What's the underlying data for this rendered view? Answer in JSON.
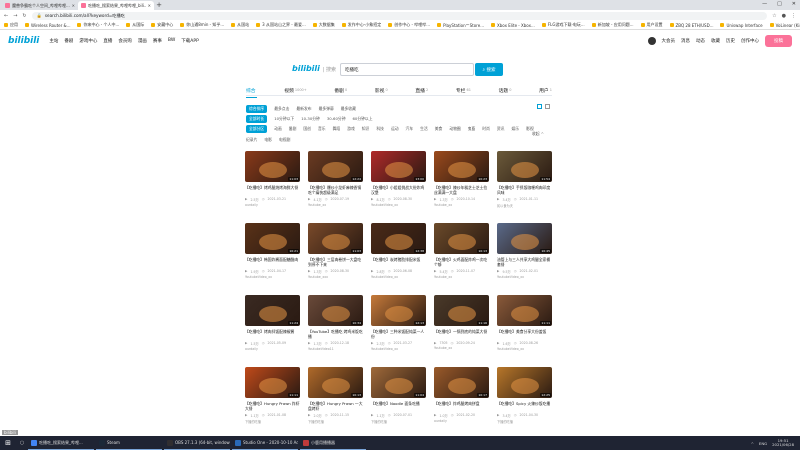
{
  "browser": {
    "tabs": [
      {
        "label": "魔兽争霸吃个人空间_哔哩哔哩..."
      },
      {
        "label": "吃播吃_搜索结果_哔哩哔哩_bili..."
      }
    ],
    "new_tab": "+",
    "window_controls": [
      "—",
      "□",
      "✕"
    ],
    "url": "search.bilibili.com/all?keyword=吃播吃",
    "bookmarks": [
      "应用",
      "Wireless Router &...",
      "你来中心 - 个人中...",
      "从国际",
      "安藏中心",
      "你山通8min - 知乎...",
      "从国站",
      "3 从国站山之界 - 最爱...",
      "大数据集",
      "发作中心-小象招定",
      "创作中心 - 哔哩哔...",
      "PlayStation™Store...",
      "Xbox Elite - Xbox...",
      "FLG游戏下载-电玩...",
      "新加坡 - 应用问题...",
      "用户设置",
      "ZBQ 28 ETH/USD...",
      "Uniswap Interface",
      "VoLinear (Kindle...",
      "Microsoft account...",
      "其他书签"
    ]
  },
  "topnav": {
    "logo": "bilibili",
    "left_links": [
      "主站",
      "番剧",
      "游戏中心",
      "直播",
      "会员购",
      "漫画",
      "赛事",
      "BW",
      "下载APP"
    ],
    "right_links": [
      "大会员",
      "消息",
      "动态",
      "收藏",
      "历史",
      "创作中心"
    ],
    "upload": "投稿"
  },
  "search": {
    "logo": "bilibili",
    "logo_sub": "| 搜索",
    "query": "吃播吃",
    "button": "搜索"
  },
  "type_tabs": [
    {
      "label": "综合",
      "count": ""
    },
    {
      "label": "视频",
      "count": "1000+"
    },
    {
      "label": "番剧",
      "count": "0"
    },
    {
      "label": "影视",
      "count": "0"
    },
    {
      "label": "直播",
      "count": "2"
    },
    {
      "label": "专栏",
      "count": "61"
    },
    {
      "label": "话题",
      "count": "0"
    },
    {
      "label": "用户",
      "count": "1"
    }
  ],
  "filters": {
    "order": [
      "综合排序",
      "最多点击",
      "最新发布",
      "最多弹幕",
      "最多收藏"
    ],
    "duration": [
      "全部时长",
      "10分钟以下",
      "10-30分钟",
      "30-60分钟",
      "60分钟以上"
    ],
    "zones": [
      "全部分区",
      "动画",
      "番剧",
      "国创",
      "音乐",
      "舞蹈",
      "游戏",
      "知识",
      "科技",
      "运动",
      "汽车",
      "生活",
      "美食",
      "动物圈",
      "鬼畜",
      "时尚",
      "资讯",
      "娱乐",
      "影视",
      "纪录片",
      "电影",
      "电视剧"
    ],
    "fold": "收起 ^"
  },
  "videos": [
    {
      "title": "【吃播吃】烤鸡腿烧烤海鲜大餐",
      "duration": "11:03",
      "views": "2.5万",
      "date": "2021-03-21",
      "up": "ourdaily",
      "color": "#8a3a1a"
    },
    {
      "title": "【吃播吃】爆炒小龙虾麻辣香锅吃个痛快超级满足",
      "duration": "12:24",
      "views": "4.1万",
      "date": "2020-07-19",
      "up": "Youtube_xx",
      "color": "#6b3b22"
    },
    {
      "title": "【吃播吃】小姐姐挑战大份炸鸡汉堡",
      "duration": "13:00",
      "views": "8.1万",
      "date": "2020-08-30",
      "up": "YoutubeVideo_xx",
      "color": "#b02a2a"
    },
    {
      "title": "【吃播吃】辣炒年糕芝士芝士拉丝满满一大盘",
      "duration": "10:23",
      "views": "1.3万",
      "date": "2020-10-14",
      "up": "Youtube_xx",
      "color": "#9b4a1c"
    },
    {
      "title": "【吃播吃】手抓饭咖喱鸡肉印度风味",
      "duration": "11:54",
      "views": "3.4万",
      "date": "2021-01-11",
      "up": "民以食为天",
      "color": "#6b5a3a"
    },
    {
      "title": "【吃播吃】韩国炸酱面配糖醋肉",
      "duration": "10:21",
      "views": "1.9万",
      "date": "2021-04-17",
      "up": "YoutubeVideo_xx",
      "color": "#5a3218"
    },
    {
      "title": "【吃播吃】三层肉卷饼一大盘吃到停不下来",
      "duration": "11:03",
      "views": "1.3万",
      "date": "2020-08-30",
      "up": "Youtube_xxx",
      "color": "#7a4a2a"
    },
    {
      "title": "【吃播吃】炭烤猪肋排配米饭",
      "duration": "12:38",
      "views": "2.8万",
      "date": "2020-06-08",
      "up": "YoutubeVideo_xx",
      "color": "#4a2a18"
    },
    {
      "title": "【吃播吃】火鸡面配炸鸡一次吃个够",
      "duration": "10:13",
      "views": "5.4万",
      "date": "2020-11-07",
      "up": "Youtube_xx",
      "color": "#6b4a2a"
    },
    {
      "title": "油管上与三人共享大鸡腿全家桶套餐",
      "duration": "10:45",
      "views": "9.5万",
      "date": "2021-02-01",
      "up": "YoutubeVideo_xx",
      "color": "#5a6a8a"
    },
    {
      "title": "【吃播吃】烤肉拌饭配辣椒酱",
      "duration": "11:24",
      "views": "1.5万",
      "date": "2021-05-09",
      "up": "ourdaily",
      "color": "#3a2a22"
    },
    {
      "title": "【YouTube】吃播吃 烤鸡米饭吃播",
      "duration": "10:34",
      "views": "1.3万",
      "date": "2020-12-18",
      "up": "YoutubeVideo11",
      "color": "#6a4a3a"
    },
    {
      "title": "【吃播吃】三种米饭配炖菜一人份",
      "duration": "12:13",
      "views": "2.3万",
      "date": "2021-03-27",
      "up": "YoutubeVideo_xx",
      "color": "#c67a3a"
    },
    {
      "title": "【吃播吃】一锅到底的炖菜大餐",
      "duration": "11:16",
      "views": "7305",
      "date": "2020-09-24",
      "up": "Youtube_xx",
      "color": "#4a3a2a"
    },
    {
      "title": "【吃播吃】美食分享大份盖饭",
      "duration": "11:11",
      "views": "1.6万",
      "date": "2020-08-26",
      "up": "YoutubeVideo_xx",
      "color": "#8a5a3a"
    },
    {
      "title": "【吃播吃】Hungry Prawn 炸虾大餐",
      "duration": "11:11",
      "views": "1.1万",
      "date": "2021-01-08",
      "up": "下播的吃播",
      "color": "#c04a1a"
    },
    {
      "title": "【吃播吃】Hungry Prawn 一大盘烤虾",
      "duration": "10:13",
      "views": "2.0万",
      "date": "2020-11-15",
      "up": "下播的吃播",
      "color": "#b06a2a"
    },
    {
      "title": "【吃播吃】Noodle 面条吃播",
      "duration": "11:04",
      "views": "1.1万",
      "date": "2020-07-01",
      "up": "下播的吃播",
      "color": "#a06a3a"
    },
    {
      "title": "【吃播吃】炸鸡腿烤肉拼盘",
      "duration": "10:17",
      "views": "1.0万",
      "date": "2021-02-20",
      "up": "ourdaily",
      "color": "#9a5a2a"
    },
    {
      "title": "【吃播吃】Spicy 火辣炒饭吃播",
      "duration": "12:25",
      "views": "3.4万",
      "date": "2021-04-30",
      "up": "下播的吃播",
      "color": "#b8772a"
    }
  ],
  "taskbar": {
    "start": "⊞",
    "search": "○",
    "items": [
      {
        "label": "吃播吃_搜索结果_哔哩...",
        "color": "#4285f4"
      },
      {
        "label": "Steam",
        "color": "#1b2838"
      },
      {
        "label": "OBS 27.1.3 (64-bit, windows)",
        "color": "#302e31"
      },
      {
        "label": "Studio One - 2020-10-10 Advis...",
        "color": "#2a6ab8"
      },
      {
        "label": "小鹿用播播器",
        "color": "#c03a3a"
      }
    ],
    "tray": [
      "^",
      "ENG",
      "19:51",
      "2021/06/28"
    ]
  },
  "watermark": "bilibili"
}
